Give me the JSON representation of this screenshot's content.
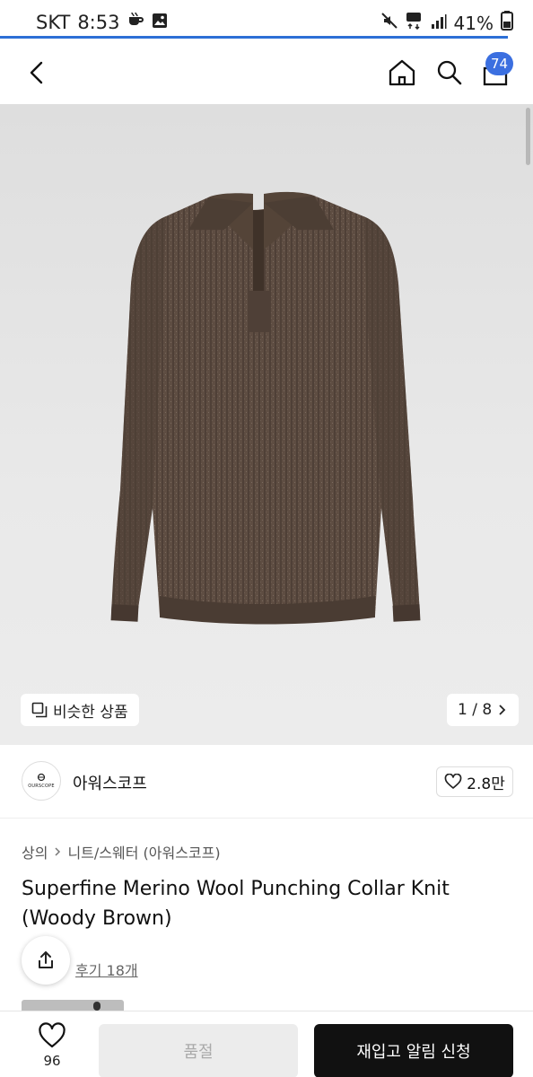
{
  "status_bar": {
    "carrier": "SKT",
    "time": "8:53",
    "network": "5G",
    "battery": "41%",
    "left_icons": [
      "coffee-icon",
      "image-icon"
    ],
    "right_icons": [
      "mute-icon",
      "network-5g-icon",
      "signal-icon",
      "battery-icon"
    ]
  },
  "header": {
    "cart_count": "74",
    "accent_color": "#3b6fe0"
  },
  "gallery": {
    "similar_label": "비슷한 상품",
    "page_indicator": "1 / 8",
    "sweater_color": "#5e4d42"
  },
  "brand": {
    "name": "아워스코프",
    "logo_text": "OURSCOPE",
    "likes": "2.8만"
  },
  "breadcrumb": {
    "items": [
      "상의",
      "니트/스웨터 (아워스코프)"
    ]
  },
  "product": {
    "title": "Superfine Merino Wool Punching Collar Knit (Woody Brown)"
  },
  "reviews": {
    "label": "후기 18개"
  },
  "bottom_bar": {
    "wish_count": "96",
    "soldout_label": "품절",
    "restock_label": "재입고 알림 신청"
  }
}
